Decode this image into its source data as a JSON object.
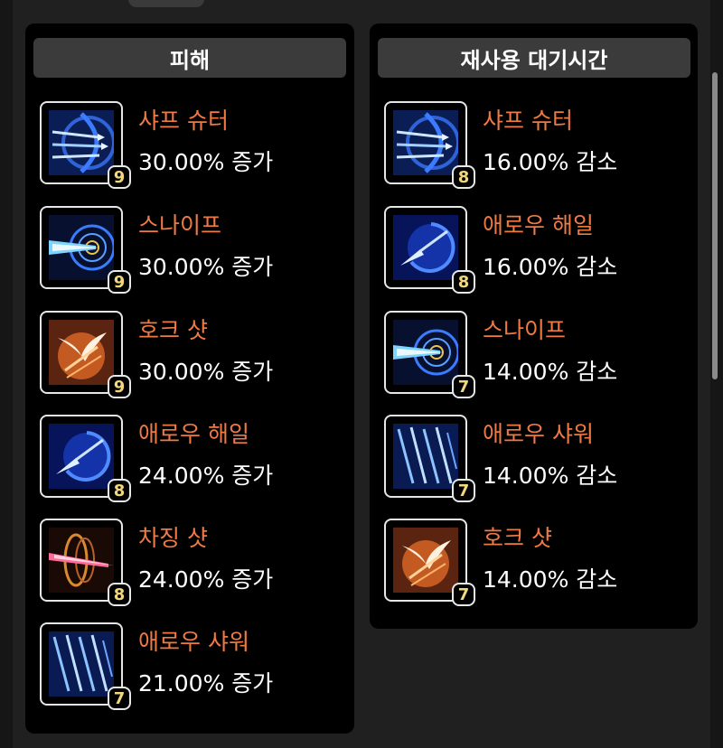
{
  "damage_panel": {
    "title": "피해",
    "items": [
      {
        "name": "샤프 슈터",
        "value": "30.00% 증가",
        "level": "9",
        "icon": "sharp-shooter-icon"
      },
      {
        "name": "스나이프",
        "value": "30.00% 증가",
        "level": "9",
        "icon": "snipe-icon"
      },
      {
        "name": "호크 샷",
        "value": "30.00% 증가",
        "level": "9",
        "icon": "hawk-shot-icon"
      },
      {
        "name": "애로우 해일",
        "value": "24.00% 증가",
        "level": "8",
        "icon": "arrow-hail-icon"
      },
      {
        "name": "차징 샷",
        "value": "24.00% 증가",
        "level": "8",
        "icon": "charging-shot-icon"
      },
      {
        "name": "애로우 샤워",
        "value": "21.00% 증가",
        "level": "7",
        "icon": "arrow-shower-icon"
      }
    ]
  },
  "cooldown_panel": {
    "title": "재사용 대기시간",
    "items": [
      {
        "name": "샤프 슈터",
        "value": "16.00% 감소",
        "level": "8",
        "icon": "sharp-shooter-icon"
      },
      {
        "name": "애로우 해일",
        "value": "16.00% 감소",
        "level": "8",
        "icon": "arrow-hail-icon"
      },
      {
        "name": "스나이프",
        "value": "14.00% 감소",
        "level": "7",
        "icon": "snipe-icon"
      },
      {
        "name": "애로우 샤워",
        "value": "14.00% 감소",
        "level": "7",
        "icon": "arrow-shower-icon"
      },
      {
        "name": "호크 샷",
        "value": "14.00% 감소",
        "level": "7",
        "icon": "hawk-shot-icon"
      }
    ]
  },
  "colors": {
    "skill_name": "#f07a44",
    "value_text": "#ffffff",
    "level_text": "#f2d77c",
    "panel_bg": "#000000",
    "header_bg": "#3b3b3b"
  }
}
